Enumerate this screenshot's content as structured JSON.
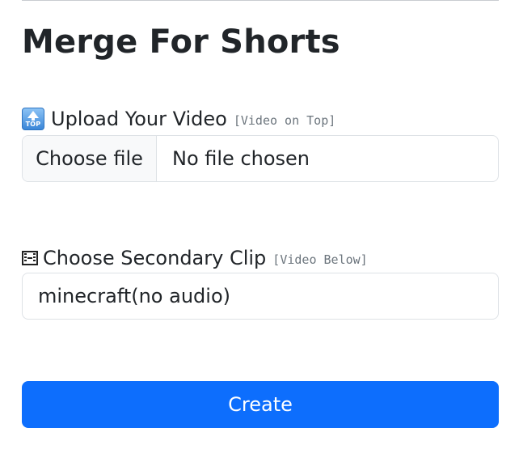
{
  "page": {
    "title": "Merge For Shorts"
  },
  "upload": {
    "icon": "top-arrow-icon",
    "label": "Upload Your Video",
    "hint": "[Video on Top]",
    "button_label": "Choose file",
    "status": "No file chosen"
  },
  "secondary": {
    "icon": "film-frames-icon",
    "label": "Choose Secondary Clip",
    "hint": "[Video Below]",
    "selected": "minecraft(no audio)"
  },
  "actions": {
    "create_label": "Create"
  },
  "colors": {
    "primary": "#0d6efd",
    "text": "#212529",
    "muted": "#6c757d",
    "border": "#dee2e6",
    "button_bg": "#f8f9fa"
  },
  "icon_text": {
    "top": "TOP"
  }
}
